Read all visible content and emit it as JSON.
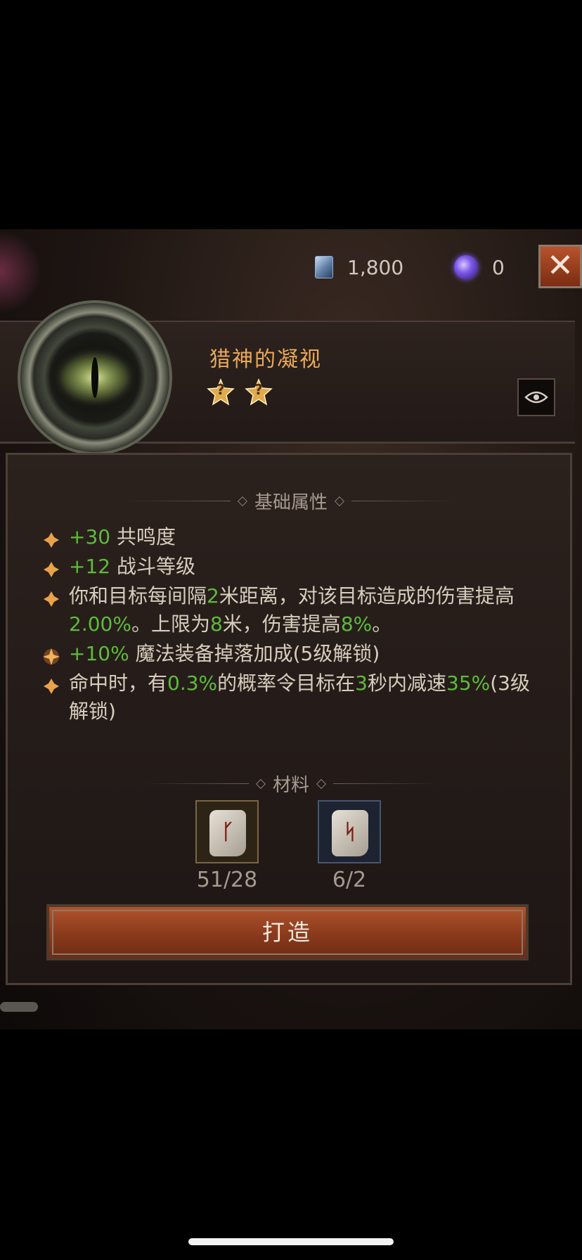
{
  "currency": {
    "gems": "1,800",
    "orbs": "0"
  },
  "close_label": "✕",
  "item": {
    "title": "猎神的凝视",
    "stars": [
      "?",
      "?"
    ]
  },
  "attributes_header": "基础属性",
  "attributes": [
    {
      "parts": [
        [
          "g",
          "+30"
        ],
        [
          "t",
          " 共鸣度"
        ]
      ],
      "glow": false
    },
    {
      "parts": [
        [
          "g",
          "+12"
        ],
        [
          "t",
          " 战斗等级"
        ]
      ],
      "glow": false
    },
    {
      "parts": [
        [
          "t",
          "你和目标每间隔"
        ],
        [
          "g",
          "2"
        ],
        [
          "t",
          "米距离，对该目标造成的伤害提高"
        ],
        [
          "g",
          "2.00%"
        ],
        [
          "t",
          "。上限为"
        ],
        [
          "g",
          "8"
        ],
        [
          "t",
          "米，伤害提高"
        ],
        [
          "g",
          "8%"
        ],
        [
          "t",
          "。"
        ]
      ],
      "glow": false
    },
    {
      "parts": [
        [
          "g",
          "+10%"
        ],
        [
          "t",
          " 魔法装备掉落加成(5级解锁)"
        ]
      ],
      "glow": true
    },
    {
      "parts": [
        [
          "t",
          "命中时，有"
        ],
        [
          "g",
          "0.3%"
        ],
        [
          "t",
          "的概率令目标在"
        ],
        [
          "g",
          "3"
        ],
        [
          "t",
          "秒内减速"
        ],
        [
          "g",
          "35%"
        ],
        [
          "t",
          "(3级解锁)"
        ]
      ],
      "glow": false
    }
  ],
  "materials_header": "材料",
  "materials": [
    {
      "count": "51/28",
      "rune": "ᚴ"
    },
    {
      "count": "6/2",
      "rune": "ᛋ"
    }
  ],
  "craft_button": "打造",
  "colors": {
    "title": "#e9a95a",
    "highlight": "#5dbb3c",
    "button": "#a34a26"
  }
}
